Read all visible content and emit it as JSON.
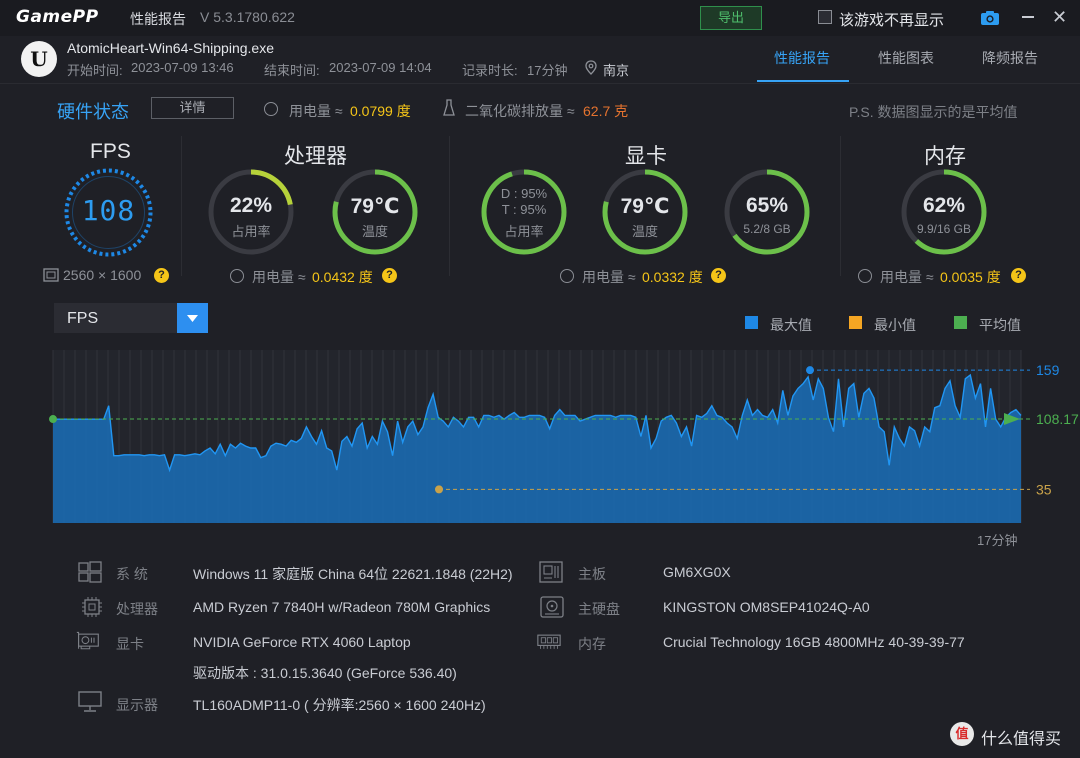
{
  "titlebar": {
    "logo": "GamePP",
    "app_name": "性能报告",
    "version": "V 5.3.1780.622",
    "export_label": "导出",
    "no_display_label": "该游戏不再显示",
    "icons": [
      "camera-icon",
      "minimize-icon",
      "close-icon"
    ]
  },
  "header": {
    "exe_name": "AtomicHeart-Win64-Shipping.exe",
    "start_label": "开始时间:",
    "start_time": "2023-07-09 13:46",
    "end_label": "结束时间:",
    "end_time": "2023-07-09 14:04",
    "duration_label": "记录时长:",
    "duration": "17分钟",
    "location": "南京",
    "tabs": [
      {
        "label": "性能报告",
        "active": true
      },
      {
        "label": "性能图表",
        "active": false
      },
      {
        "label": "降频报告",
        "active": false
      }
    ]
  },
  "hardware_status": {
    "title": "硬件状态",
    "detail_button": "详情",
    "power_label": "用电量 ≈",
    "power_value": "0.0799 度",
    "co2_label": "二氧化碳排放量 ≈",
    "co2_value": "62.7 克",
    "note": "P.S. 数据图显示的是平均值"
  },
  "fps": {
    "title": "FPS",
    "value": "108",
    "resolution": "2560 × 1600",
    "help": "?"
  },
  "cpu": {
    "title": "处理器",
    "usage": {
      "value": "22%",
      "label": "占用率",
      "fraction": 0.22
    },
    "temp": {
      "value": "79℃",
      "label": "温度",
      "fraction": 0.79
    },
    "power_label": "用电量 ≈",
    "power_value": "0.0432 度"
  },
  "gpu": {
    "title": "显卡",
    "usage": {
      "d": "D : 95%",
      "t": "T : 95%",
      "label": "占用率",
      "fraction": 0.95
    },
    "temp": {
      "value": "79℃",
      "label": "温度",
      "fraction": 0.79
    },
    "vram": {
      "value": "65%",
      "label": "5.2/8 GB",
      "fraction": 0.65
    },
    "power_label": "用电量 ≈",
    "power_value": "0.0332 度"
  },
  "memory": {
    "title": "内存",
    "usage": {
      "value": "62%",
      "label": "9.9/16 GB",
      "fraction": 0.62
    },
    "power_label": "用电量 ≈",
    "power_value": "0.0035 度"
  },
  "chart": {
    "selected_metric": "FPS",
    "legend": [
      {
        "name": "最大值",
        "color": "#1e88e5"
      },
      {
        "name": "最小值",
        "color": "#f5a623"
      },
      {
        "name": "平均值",
        "color": "#4caf50"
      }
    ],
    "duration_label": "17分钟"
  },
  "chart_data": {
    "type": "area",
    "ylim": [
      0,
      180
    ],
    "max": 159,
    "min": 35,
    "avg": 108.17,
    "max_label": "159",
    "min_label": "35",
    "avg_label": "108.17",
    "values": [
      108,
      108,
      108,
      108,
      108,
      108,
      108,
      108,
      108,
      108,
      108,
      122,
      70,
      70,
      71,
      71,
      71,
      71,
      70,
      71,
      71,
      70,
      71,
      55,
      71,
      71,
      70,
      71,
      72,
      71,
      75,
      78,
      72,
      82,
      70,
      82,
      78,
      83,
      80,
      78,
      78,
      68,
      70,
      80,
      83,
      82,
      80,
      86,
      84,
      88,
      100,
      90,
      82,
      96,
      78,
      75,
      55,
      85,
      90,
      80,
      98,
      104,
      78,
      90,
      82,
      106,
      95,
      70,
      106,
      84,
      100,
      106,
      92,
      100,
      120,
      134,
      110,
      106,
      100,
      110,
      106,
      100,
      110,
      110,
      100,
      112,
      112,
      110,
      112,
      108,
      112,
      115,
      110,
      110,
      112,
      112,
      112,
      110,
      98,
      112,
      118,
      112,
      112,
      112,
      106,
      108,
      110,
      112,
      112,
      112,
      112,
      110,
      112,
      112,
      112,
      110,
      90,
      112,
      78,
      88,
      106,
      110,
      112,
      104,
      90,
      100,
      80,
      112,
      110,
      114,
      122,
      112,
      110,
      104,
      100,
      88,
      112,
      128,
      112,
      118,
      112,
      110,
      118,
      104,
      138,
      112,
      132,
      140,
      145,
      152,
      128,
      150,
      140,
      110,
      95,
      150,
      100,
      140,
      145,
      110,
      135,
      140,
      130,
      100,
      95,
      60,
      100,
      88,
      80,
      100,
      96,
      80,
      100,
      95,
      120,
      122,
      140,
      148,
      122,
      110,
      150,
      154,
      130,
      145,
      100,
      140,
      108,
      100,
      110,
      115,
      118,
      112
    ]
  },
  "system_info": {
    "os": {
      "label": "系 统",
      "value": "Windows 11 家庭版 China 64位 22621.1848 (22H2)"
    },
    "cpu": {
      "label": "处理器",
      "value": "AMD Ryzen 7 7840H w/Radeon 780M Graphics"
    },
    "gpu": {
      "label": "显卡",
      "value": "NVIDIA GeForce RTX 4060 Laptop",
      "driver": "驱动版本 : 31.0.15.3640 (GeForce 536.40)"
    },
    "display": {
      "label": "显示器",
      "value": "TL160ADMP11-0 ( 分辨率:2560 × 1600 240Hz)"
    },
    "board": {
      "label": "主板",
      "value": "GM6XG0X"
    },
    "disk": {
      "label": "主硬盘",
      "value": "KINGSTON OM8SEP41024Q-A0"
    },
    "ram": {
      "label": "内存",
      "value": "Crucial Technology 16GB 4800MHz 40-39-39-77"
    }
  },
  "footer": {
    "text": "什么值得买"
  }
}
